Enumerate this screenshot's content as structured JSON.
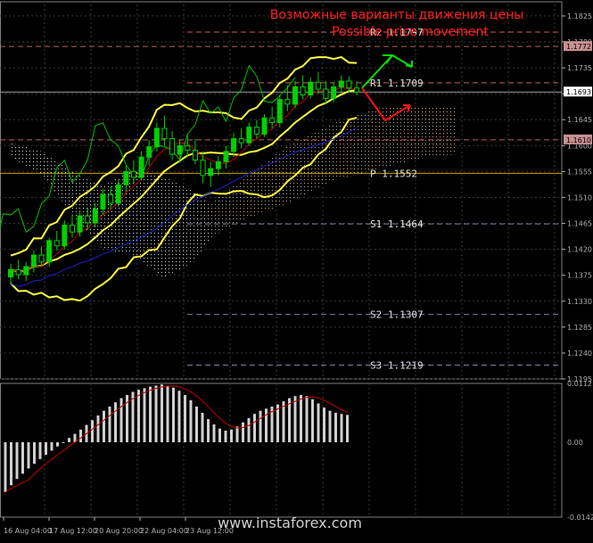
{
  "chart_data": {
    "type": "candlestick",
    "headline_ru": "Возможные варианты движения цены",
    "headline_en": "Possible price movement",
    "price_ticks": [
      "1.1825",
      "1.1780",
      "1.1735",
      "1.1690",
      "1.1645",
      "1.1600",
      "1.1555",
      "1.1510",
      "1.1465",
      "1.1420",
      "1.1375",
      "1.1330",
      "1.1285",
      "1.1240",
      "1.1195"
    ],
    "price_range": [
      1.1195,
      1.1845
    ],
    "price_badges": [
      {
        "label": "1.1772",
        "value": 1.1772,
        "color": "#c89090"
      },
      {
        "label": "1.1693",
        "value": 1.1693,
        "color": "#ffffff"
      },
      {
        "label": "1.1610",
        "value": 1.161,
        "color": "#c89090"
      }
    ],
    "pivot_levels": [
      {
        "name": "R2",
        "value": 1.1797,
        "text": "R2 1.1797",
        "color": "#d06060"
      },
      {
        "name": "R1",
        "value": 1.1709,
        "text": "R1 1.1709",
        "color": "#d06060"
      },
      {
        "name": "P",
        "value": 1.1552,
        "text": "P 1.1552",
        "color": "#c8a000"
      },
      {
        "name": "S1",
        "value": 1.1464,
        "text": "S1 1.1464",
        "color": "#8080a0"
      },
      {
        "name": "S2",
        "value": 1.1307,
        "text": "S2 1.1307",
        "color": "#8080a0"
      },
      {
        "name": "S3",
        "value": 1.1219,
        "text": "S3 1.1219",
        "color": "#8080a0"
      }
    ],
    "extra_levels": [
      1.1772,
      1.161
    ],
    "time_labels": [
      "16 Aug 04:00",
      "17 Aug 12:00",
      "20 Aug 20:00",
      "22 Aug 04:00",
      "23 Aug 12:00"
    ],
    "candles": [
      [
        1.1372,
        1.1395,
        1.136,
        1.1385
      ],
      [
        1.1385,
        1.1402,
        1.1368,
        1.1376
      ],
      [
        1.1376,
        1.1398,
        1.1365,
        1.139
      ],
      [
        1.139,
        1.1418,
        1.138,
        1.141
      ],
      [
        1.141,
        1.1425,
        1.1392,
        1.1398
      ],
      [
        1.1398,
        1.144,
        1.139,
        1.1435
      ],
      [
        1.1435,
        1.1452,
        1.1418,
        1.1426
      ],
      [
        1.1426,
        1.147,
        1.142,
        1.1462
      ],
      [
        1.1462,
        1.148,
        1.144,
        1.145
      ],
      [
        1.145,
        1.1488,
        1.1442,
        1.1478
      ],
      [
        1.1478,
        1.1492,
        1.1455,
        1.1466
      ],
      [
        1.1466,
        1.15,
        1.1458,
        1.149
      ],
      [
        1.149,
        1.1525,
        1.148,
        1.1515
      ],
      [
        1.1515,
        1.153,
        1.149,
        1.15
      ],
      [
        1.15,
        1.154,
        1.1495,
        1.1532
      ],
      [
        1.1532,
        1.1565,
        1.152,
        1.1555
      ],
      [
        1.1555,
        1.1575,
        1.1535,
        1.1545
      ],
      [
        1.1545,
        1.159,
        1.154,
        1.158
      ],
      [
        1.158,
        1.161,
        1.1565,
        1.1598
      ],
      [
        1.1598,
        1.164,
        1.159,
        1.163
      ],
      [
        1.163,
        1.1652,
        1.16,
        1.1612
      ],
      [
        1.1612,
        1.1625,
        1.1575,
        1.1585
      ],
      [
        1.1585,
        1.161,
        1.157,
        1.16
      ],
      [
        1.16,
        1.1618,
        1.158,
        1.1592
      ],
      [
        1.1592,
        1.1612,
        1.1568,
        1.1575
      ],
      [
        1.1575,
        1.159,
        1.1535,
        1.1548
      ],
      [
        1.1548,
        1.1572,
        1.1528,
        1.156
      ],
      [
        1.156,
        1.1582,
        1.1548,
        1.1572
      ],
      [
        1.1572,
        1.16,
        1.156,
        1.159
      ],
      [
        1.159,
        1.1622,
        1.158,
        1.1612
      ],
      [
        1.1612,
        1.163,
        1.1595,
        1.1605
      ],
      [
        1.1605,
        1.164,
        1.16,
        1.1632
      ],
      [
        1.1632,
        1.1645,
        1.1612,
        1.162
      ],
      [
        1.162,
        1.1655,
        1.1615,
        1.1648
      ],
      [
        1.1648,
        1.1668,
        1.163,
        1.164
      ],
      [
        1.164,
        1.1688,
        1.1632,
        1.168
      ],
      [
        1.168,
        1.1705,
        1.166,
        1.1672
      ],
      [
        1.1672,
        1.1712,
        1.1665,
        1.1702
      ],
      [
        1.1702,
        1.1722,
        1.168,
        1.1688
      ],
      [
        1.1688,
        1.1718,
        1.1682,
        1.171
      ],
      [
        1.171,
        1.1728,
        1.169,
        1.1698
      ],
      [
        1.1698,
        1.1712,
        1.1672,
        1.1682
      ],
      [
        1.1682,
        1.171,
        1.1675,
        1.1702
      ],
      [
        1.1702,
        1.1722,
        1.169,
        1.1712
      ],
      [
        1.1712,
        1.172,
        1.1692,
        1.17
      ],
      [
        1.17,
        1.1712,
        1.1688,
        1.1693
      ]
    ],
    "oscillator": {
      "ticks": [
        "0.01121",
        "0.00",
        "-0.01427"
      ],
      "range": [
        -0.01427,
        0.01121
      ],
      "histogram": [
        -0.0095,
        -0.0082,
        -0.007,
        -0.006,
        -0.005,
        -0.0041,
        -0.0032,
        -0.0024,
        -0.0016,
        -0.0008,
        0.0,
        0.0008,
        0.0016,
        0.0024,
        0.0033,
        0.0042,
        0.0051,
        0.006,
        0.0068,
        0.0076,
        0.0084,
        0.009,
        0.0096,
        0.01,
        0.0103,
        0.0106,
        0.0108,
        0.011,
        0.0108,
        0.0104,
        0.0098,
        0.009,
        0.008,
        0.0068,
        0.0056,
        0.0044,
        0.0034,
        0.0026,
        0.0022,
        0.0024,
        0.003,
        0.0038,
        0.0046,
        0.0054,
        0.006,
        0.0064,
        0.0068,
        0.0072,
        0.0078,
        0.0084,
        0.0088,
        0.009,
        0.0088,
        0.0082,
        0.0074,
        0.0066,
        0.006,
        0.0056,
        0.0054,
        0.0052
      ]
    }
  },
  "watermark": "www.instaforex.com",
  "colors": {
    "background": "#000000",
    "grid": "#3a3a3a",
    "axis": "#b0b0b0",
    "headline": "#ff2020",
    "bull_candle": "#00d000",
    "bear_candle": "#000000",
    "bollinger": "#ffff40",
    "sma_red": "#c00000",
    "sma_blue": "#2020c0",
    "line_green": "#00c000",
    "arrow_up": "#00e000",
    "arrow_down": "#ff1010"
  }
}
